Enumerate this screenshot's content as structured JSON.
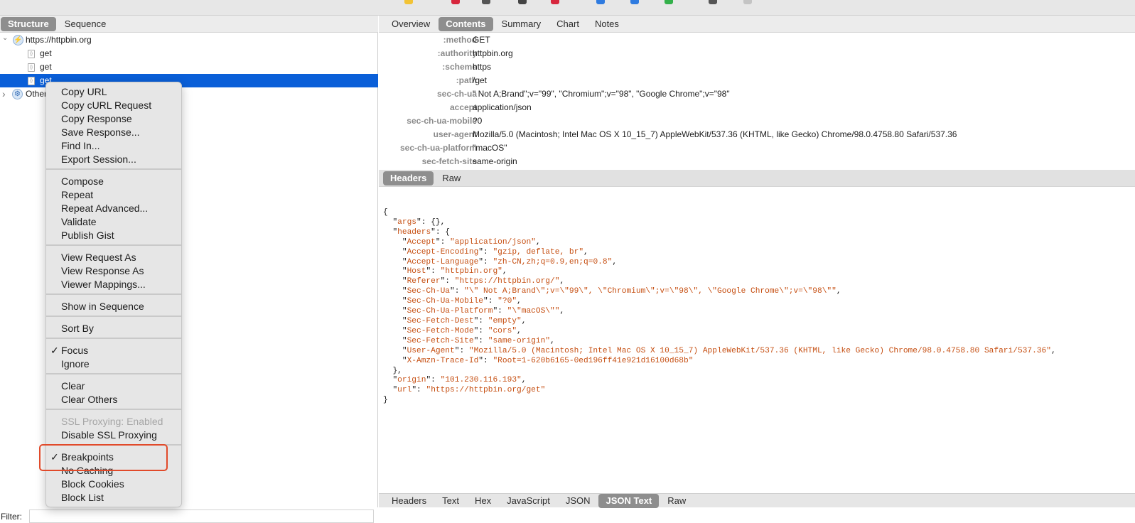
{
  "toolbar": {
    "icons": [
      "lightbulb-icon",
      "record-icon",
      "throttle-icon",
      "breakpoint-icon",
      "check-icon",
      "pen-icon",
      "refresh-icon",
      "tick-icon",
      "tools-icon",
      "settings-icon"
    ]
  },
  "left": {
    "tabs": [
      "Structure",
      "Sequence"
    ],
    "selected_tab": "Structure",
    "tree": {
      "host": "https://httpbin.org",
      "children": [
        "get",
        "get",
        "get"
      ],
      "other": "Other"
    },
    "filter_label": "Filter:"
  },
  "context_menu": {
    "groups": [
      [
        {
          "label": "Copy URL"
        },
        {
          "label": "Copy cURL Request"
        },
        {
          "label": "Copy Response"
        },
        {
          "label": "Save Response..."
        },
        {
          "label": "Find In..."
        },
        {
          "label": "Export Session..."
        }
      ],
      [
        {
          "label": "Compose"
        },
        {
          "label": "Repeat"
        },
        {
          "label": "Repeat Advanced..."
        },
        {
          "label": "Validate"
        },
        {
          "label": "Publish Gist"
        }
      ],
      [
        {
          "label": "View Request As",
          "submenu": true
        },
        {
          "label": "View Response As",
          "submenu": true
        },
        {
          "label": "Viewer Mappings..."
        }
      ],
      [
        {
          "label": "Show in Sequence"
        }
      ],
      [
        {
          "label": "Sort By",
          "submenu": true
        }
      ],
      [
        {
          "label": "Focus",
          "checked": true
        },
        {
          "label": "Ignore"
        }
      ],
      [
        {
          "label": "Clear"
        },
        {
          "label": "Clear Others"
        }
      ],
      [
        {
          "label": "SSL Proxying: Enabled",
          "disabled": true
        },
        {
          "label": "Disable SSL Proxying"
        }
      ],
      [
        {
          "label": "Breakpoints",
          "checked": true
        },
        {
          "label": "No Caching"
        },
        {
          "label": "Block Cookies"
        },
        {
          "label": "Block List"
        }
      ]
    ]
  },
  "right": {
    "tabs": [
      "Overview",
      "Contents",
      "Summary",
      "Chart",
      "Notes"
    ],
    "selected_tab": "Contents",
    "request_headers": [
      {
        "name": ":method",
        "value": "GET"
      },
      {
        "name": ":authority",
        "value": "httpbin.org"
      },
      {
        "name": ":scheme",
        "value": "https"
      },
      {
        "name": ":path",
        "value": "/get"
      },
      {
        "name": "sec-ch-ua",
        "value": "\" Not A;Brand\";v=\"99\", \"Chromium\";v=\"98\", \"Google Chrome\";v=\"98\""
      },
      {
        "name": "accept",
        "value": "application/json"
      },
      {
        "name": "sec-ch-ua-mobile",
        "value": "?0"
      },
      {
        "name": "user-agent",
        "value": "Mozilla/5.0 (Macintosh; Intel Mac OS X 10_15_7) AppleWebKit/537.36 (KHTML, like Gecko) Chrome/98.0.4758.80 Safari/537.36"
      },
      {
        "name": "sec-ch-ua-platform",
        "value": "\"macOS\""
      },
      {
        "name": "sec-fetch-site",
        "value": "same-origin"
      }
    ],
    "request_tabs": [
      "Headers",
      "Raw"
    ],
    "request_selected": "Headers",
    "response_json": [
      {
        "indent": 0,
        "text": "{"
      },
      {
        "indent": 1,
        "key": "args",
        "rest": ": {},"
      },
      {
        "indent": 1,
        "key": "headers",
        "rest": ": {"
      },
      {
        "indent": 2,
        "key": "Accept",
        "value": "application/json",
        "tail": ","
      },
      {
        "indent": 2,
        "key": "Accept-Encoding",
        "value": "gzip, deflate, br",
        "tail": ","
      },
      {
        "indent": 2,
        "key": "Accept-Language",
        "value": "zh-CN,zh;q=0.9,en;q=0.8",
        "tail": ","
      },
      {
        "indent": 2,
        "key": "Host",
        "value": "httpbin.org",
        "tail": ","
      },
      {
        "indent": 2,
        "key": "Referer",
        "value": "https://httpbin.org/",
        "tail": ","
      },
      {
        "indent": 2,
        "key": "Sec-Ch-Ua",
        "value": "\\\" Not A;Brand\\\";v=\\\"99\\\", \\\"Chromium\\\";v=\\\"98\\\", \\\"Google Chrome\\\";v=\\\"98\\\"",
        "tail": ","
      },
      {
        "indent": 2,
        "key": "Sec-Ch-Ua-Mobile",
        "value": "?0",
        "tail": ","
      },
      {
        "indent": 2,
        "key": "Sec-Ch-Ua-Platform",
        "value": "\\\"macOS\\\"",
        "tail": ","
      },
      {
        "indent": 2,
        "key": "Sec-Fetch-Dest",
        "value": "empty",
        "tail": ","
      },
      {
        "indent": 2,
        "key": "Sec-Fetch-Mode",
        "value": "cors",
        "tail": ","
      },
      {
        "indent": 2,
        "key": "Sec-Fetch-Site",
        "value": "same-origin",
        "tail": ","
      },
      {
        "indent": 2,
        "key": "User-Agent",
        "value": "Mozilla/5.0 (Macintosh; Intel Mac OS X 10_15_7) AppleWebKit/537.36 (KHTML, like Gecko) Chrome/98.0.4758.80 Safari/537.36",
        "tail": ","
      },
      {
        "indent": 2,
        "key": "X-Amzn-Trace-Id",
        "value": "Root=1-620b6165-0ed196ff41e921d16100d68b",
        "tail": ""
      },
      {
        "indent": 1,
        "text": "},"
      },
      {
        "indent": 1,
        "key": "origin",
        "value": "101.230.116.193",
        "tail": ","
      },
      {
        "indent": 1,
        "key": "url",
        "value": "https://httpbin.org/get",
        "tail": ""
      },
      {
        "indent": 0,
        "text": "}"
      }
    ],
    "response_tabs": [
      "Headers",
      "Text",
      "Hex",
      "JavaScript",
      "JSON",
      "JSON Text",
      "Raw"
    ],
    "response_selected": "JSON Text"
  },
  "colors": {
    "selection": "#0a5fd8",
    "json_key": "#c64f12",
    "highlight_box": "#e14a2a"
  }
}
